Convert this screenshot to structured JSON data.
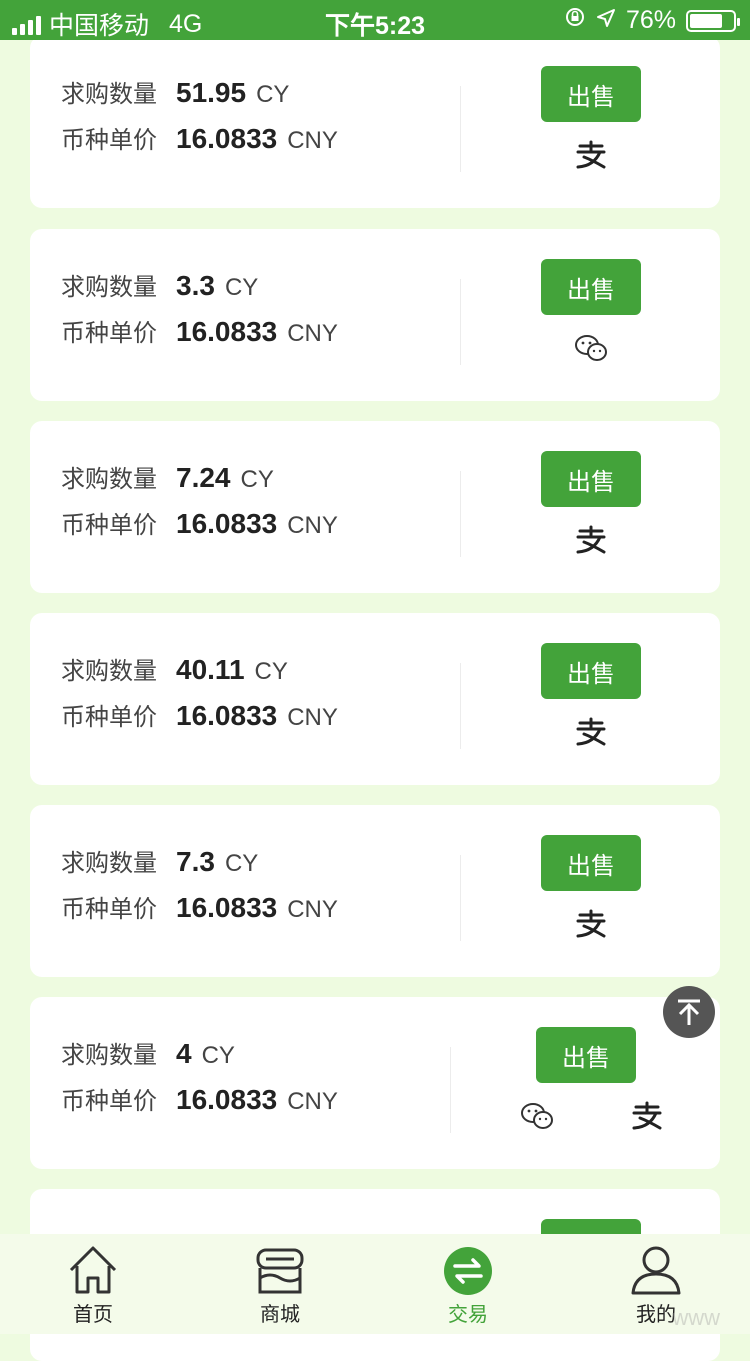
{
  "status_bar": {
    "carrier": "中国移动",
    "network": "4G",
    "time": "下午5:23",
    "battery": "76%",
    "battery_level": 0.76
  },
  "labels": {
    "quantity": "求购数量",
    "price": "币种单价",
    "sell": "出售"
  },
  "orders": [
    {
      "quantity": "51.95",
      "quantity_unit": "CY",
      "price": "16.0833",
      "price_unit": "CNY",
      "payments": [
        "alipay"
      ]
    },
    {
      "quantity": "3.3",
      "quantity_unit": "CY",
      "price": "16.0833",
      "price_unit": "CNY",
      "payments": [
        "wechat"
      ]
    },
    {
      "quantity": "7.24",
      "quantity_unit": "CY",
      "price": "16.0833",
      "price_unit": "CNY",
      "payments": [
        "alipay"
      ]
    },
    {
      "quantity": "40.11",
      "quantity_unit": "CY",
      "price": "16.0833",
      "price_unit": "CNY",
      "payments": [
        "alipay"
      ]
    },
    {
      "quantity": "7.3",
      "quantity_unit": "CY",
      "price": "16.0833",
      "price_unit": "CNY",
      "payments": [
        "alipay"
      ]
    },
    {
      "quantity": "4",
      "quantity_unit": "CY",
      "price": "16.0833",
      "price_unit": "CNY",
      "payments": [
        "wechat",
        "alipay"
      ]
    }
  ],
  "nav": [
    {
      "label": "首页",
      "icon": "home-icon"
    },
    {
      "label": "商城",
      "icon": "store-icon"
    },
    {
      "label": "交易",
      "icon": "exchange-icon",
      "active": true
    },
    {
      "label": "我的",
      "icon": "user-icon"
    }
  ],
  "watermark": "www",
  "colors": {
    "accent": "#43a33a",
    "background": "#eefbe0"
  }
}
